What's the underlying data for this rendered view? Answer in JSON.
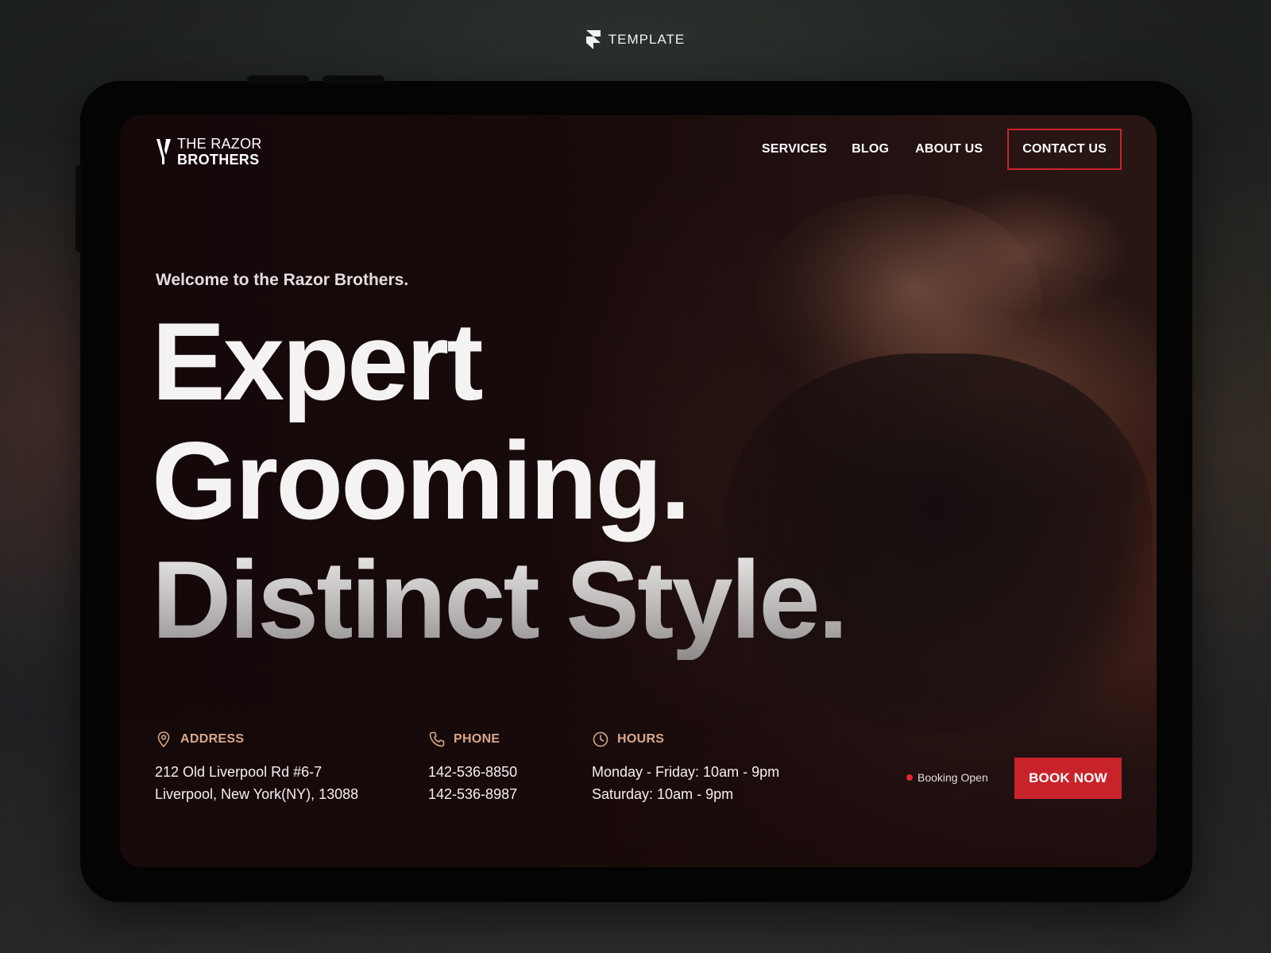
{
  "brand_badge": {
    "label": "TEMPLATE"
  },
  "site": {
    "logo": {
      "line1": "THE RAZOR",
      "line2": "BROTHERS"
    },
    "nav": {
      "services": "SERVICES",
      "blog": "BLOG",
      "about": "ABOUT US",
      "contact": "CONTACT US"
    },
    "hero": {
      "welcome": "Welcome to the Razor Brothers.",
      "line1": "Expert",
      "line2": "Grooming.",
      "line3": "Distinct Style."
    },
    "info": {
      "address": {
        "label": "ADDRESS",
        "line1": "212 Old Liverpool Rd #6-7",
        "line2": "Liverpool, New York(NY), 13088",
        "icon": "map-pin-icon"
      },
      "phone": {
        "label": "PHONE",
        "line1": "142-536-8850",
        "line2": "142-536-8987",
        "icon": "phone-icon"
      },
      "hours": {
        "label": "HOURS",
        "line1": "Monday - Friday: 10am - 9pm",
        "line2": "Saturday: 10am - 9pm",
        "icon": "clock-icon"
      }
    },
    "booking_status": "Booking Open",
    "book_button": "BOOK NOW"
  },
  "colors": {
    "accent": "#c8232a",
    "info_label": "#d8a88b",
    "background": "#190a0b"
  }
}
